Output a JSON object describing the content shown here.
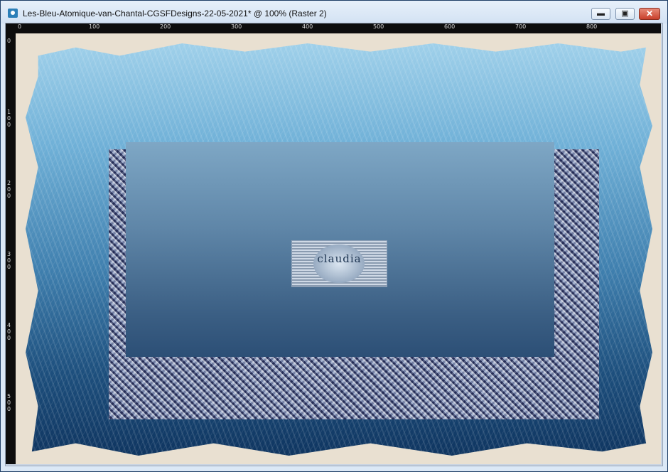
{
  "window": {
    "title": "Les-Bleu-Atomique-van-Chantal-CGSFDesigns-22-05-2021* @ 100% (Raster 2)",
    "icon": "psp-image-icon",
    "controls": {
      "minimize": "▬",
      "maximize": "▣",
      "close": "✕"
    }
  },
  "rulers": {
    "horizontal": [
      "0",
      "100",
      "200",
      "300",
      "400",
      "500",
      "600",
      "700",
      "800"
    ],
    "vertical": [
      "0",
      "100",
      "200",
      "300",
      "400",
      "500"
    ]
  },
  "canvas": {
    "watermark_text": "claudia",
    "colors": {
      "background": "#e9e0d1",
      "light_blue": "#9fd0ea",
      "dark_blue": "#0f3560"
    }
  }
}
